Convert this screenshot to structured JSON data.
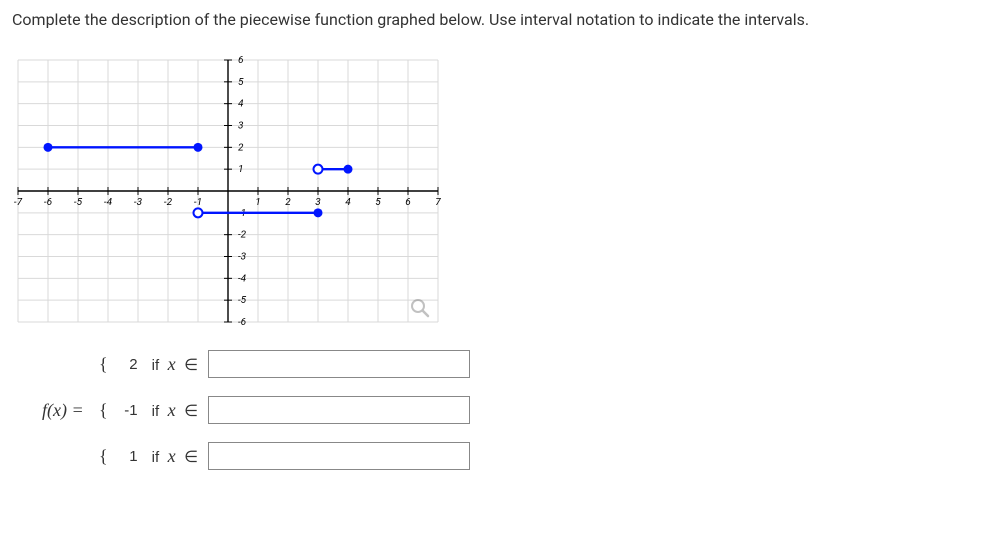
{
  "prompt": "Complete the description of the piecewise function graphed below. Use interval notation to indicate the intervals.",
  "chart_data": {
    "type": "line",
    "xlim": [
      -7,
      7
    ],
    "ylim": [
      -6,
      6
    ],
    "xticks": [
      -7,
      -6,
      -5,
      -4,
      -3,
      -2,
      -1,
      1,
      2,
      3,
      4,
      5,
      6,
      7
    ],
    "yticks": [
      -6,
      -5,
      -4,
      -3,
      -2,
      -1,
      1,
      2,
      3,
      4,
      5,
      6
    ],
    "segments": [
      {
        "y": 2,
        "x_from": -6,
        "x_to": -1,
        "left_closed": true,
        "right_closed": true
      },
      {
        "y": -1,
        "x_from": -1,
        "x_to": 3,
        "left_closed": false,
        "right_closed": true
      },
      {
        "y": 1,
        "x_from": 3,
        "x_to": 4,
        "left_closed": false,
        "right_closed": true
      }
    ]
  },
  "func": {
    "lhs": "f(x) =",
    "pieces": [
      {
        "brace": "{",
        "value": "2",
        "if": "if",
        "var": "x",
        "rel": "∈",
        "answer": ""
      },
      {
        "brace": "{",
        "value": "-1",
        "if": "if",
        "var": "x",
        "rel": "∈",
        "answer": ""
      },
      {
        "brace": "{",
        "value": "1",
        "if": "if",
        "var": "x",
        "rel": "∈",
        "answer": ""
      }
    ]
  }
}
